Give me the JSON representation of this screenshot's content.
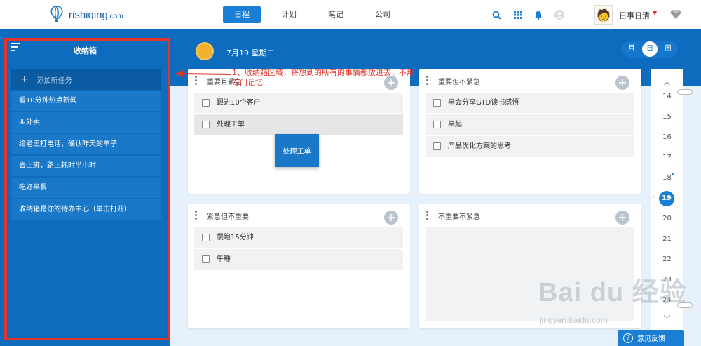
{
  "header": {
    "logo_text": "rishiqing",
    "logo_suffix": ".com",
    "tabs": [
      {
        "label": "日程",
        "active": true
      },
      {
        "label": "计划",
        "active": false
      },
      {
        "label": "笔记",
        "active": false
      },
      {
        "label": "公司",
        "active": false
      }
    ],
    "icons": [
      "search-icon",
      "grid-icon",
      "bell-icon",
      "user-circle-icon"
    ],
    "user_name": "日事日清",
    "accent": "#1a7fd4"
  },
  "sidebar": {
    "title": "收纳箱",
    "add_task_label": "添加新任务",
    "items": [
      {
        "label": "看10分钟热点新闻"
      },
      {
        "label": "叫外卖"
      },
      {
        "label": "给老王打电话，确认昨天的单子"
      },
      {
        "label": "去上班，路上耗时半小时"
      },
      {
        "label": "吃好早餐"
      },
      {
        "label": "收纳箱是你的待办中心（单击打开）"
      }
    ],
    "bg_color": "#0e6cbf"
  },
  "main": {
    "date_label": "7月19 星期二",
    "view_switch": [
      {
        "label": "月",
        "active": false
      },
      {
        "label": "日",
        "active": true
      },
      {
        "label": "周",
        "active": false
      }
    ],
    "quadrants": [
      {
        "title": "重要且紧急",
        "items": [
          {
            "label": "跟进10个客户"
          },
          {
            "label": "处理工单"
          }
        ]
      },
      {
        "title": "重要但不紧急",
        "items": [
          {
            "label": "早会分享GTD读书感悟"
          },
          {
            "label": "早起"
          },
          {
            "label": "产品优化方案的思考"
          }
        ]
      },
      {
        "title": "紧急但不重要",
        "items": [
          {
            "label": "慢跑15分钟"
          },
          {
            "label": "午睡"
          }
        ]
      },
      {
        "title": "不重要不紧急",
        "items": []
      }
    ],
    "drag_ghost_label": "处理工单"
  },
  "date_strip": {
    "days": [
      "14",
      "15",
      "16",
      "17",
      "18",
      "19",
      "20",
      "21",
      "22",
      "23",
      "24"
    ],
    "active_day": "19"
  },
  "annotation": {
    "text": "1、收纳箱区域，将想到的所有的事情都放进去，不用专门记忆",
    "color": "#e3352c"
  },
  "watermark": {
    "text": "Bai du 经验",
    "sub": "jingyan.baidu.com"
  },
  "feedback_label": "意见反馈"
}
